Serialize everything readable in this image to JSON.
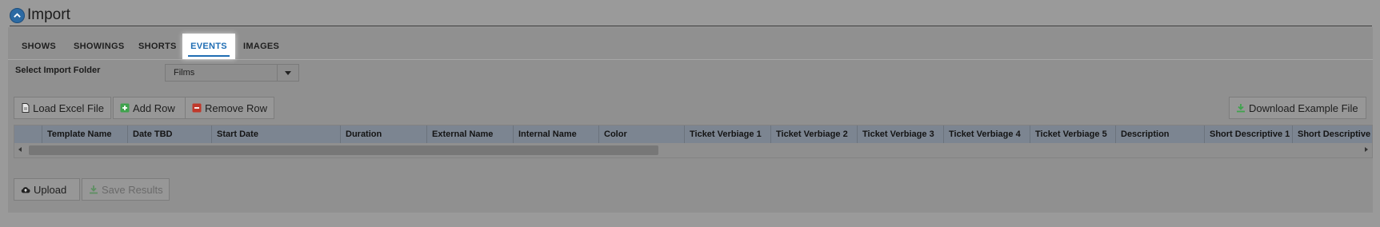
{
  "title": "Import",
  "tabs": [
    {
      "label": "SHOWS"
    },
    {
      "label": "SHOWINGS"
    },
    {
      "label": "SHORTS"
    },
    {
      "label": "EVENTS"
    },
    {
      "label": "IMAGES"
    }
  ],
  "active_tab": "EVENTS",
  "folder": {
    "label": "Select Import Folder",
    "value": "Films"
  },
  "toolbar": {
    "load_excel": "Load Excel File",
    "add_row": "Add Row",
    "remove_row": "Remove Row",
    "download_example": "Download Example File"
  },
  "columns": [
    "Template Name",
    "Date TBD",
    "Start Date",
    "Duration",
    "External Name",
    "Internal Name",
    "Color",
    "Ticket Verbiage 1",
    "Ticket Verbiage 2",
    "Ticket Verbiage 3",
    "Ticket Verbiage 4",
    "Ticket Verbiage 5",
    "Description",
    "Short Descriptive 1",
    "Short Descriptive"
  ],
  "footer": {
    "upload": "Upload",
    "save_results": "Save Results"
  },
  "colors": {
    "accent": "#1f6db3",
    "add_green": "#3fa34d",
    "remove_red": "#c0392b"
  }
}
